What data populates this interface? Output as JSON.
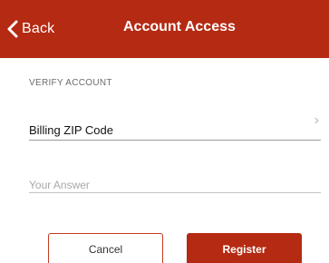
{
  "colors": {
    "accent": "#b52a12",
    "header_text": "#ffffff",
    "label_gray": "#6b6b6b"
  },
  "header": {
    "back_icon": "chevron-left-icon",
    "back_label": "Back",
    "title": "Account Access"
  },
  "form": {
    "section_label": "VERIFY ACCOUNT",
    "question_select": {
      "value": "Billing ZIP Code",
      "icon": "chevron-right-icon"
    },
    "answer_input": {
      "value": "",
      "placeholder": "Your Answer"
    }
  },
  "actions": {
    "cancel_label": "Cancel",
    "register_label": "Register"
  }
}
